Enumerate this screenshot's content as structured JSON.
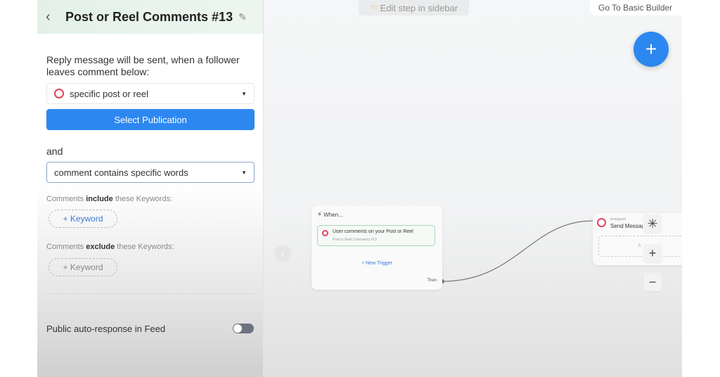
{
  "sidebar": {
    "title": "Post or Reel Comments #13",
    "description": "Reply message will be sent, when a follower leaves comment below:",
    "post_select": "specific post or reel",
    "select_publication": "Select Publication",
    "and": "and",
    "condition_select": "comment contains specific words",
    "include_pre": "Comments ",
    "include_bold": "include",
    "include_post": " these Keywords:",
    "exclude_pre": "Comments ",
    "exclude_bold": "exclude",
    "exclude_post": " these Keywords:",
    "keyword_button": "+ Keyword",
    "public_response": "Public auto-response in Feed",
    "public_response_on": false
  },
  "canvas": {
    "edit_hint": "Edit step in sidebar",
    "basic_builder": "Go To Basic Builder",
    "trigger_node": {
      "header": "When...",
      "trigger_title": "User comments on your Post or Reel",
      "trigger_sub": "Post or Reel Comments #13",
      "new_trigger": "+ New Trigger",
      "then": "Then"
    },
    "action_node": {
      "platform": "Instagram",
      "title": "Send Message",
      "placeholder": "A"
    }
  },
  "colors": {
    "accent": "#2d87f0",
    "instagram": "#e4405f",
    "trigger_border": "#a8d8b8"
  }
}
